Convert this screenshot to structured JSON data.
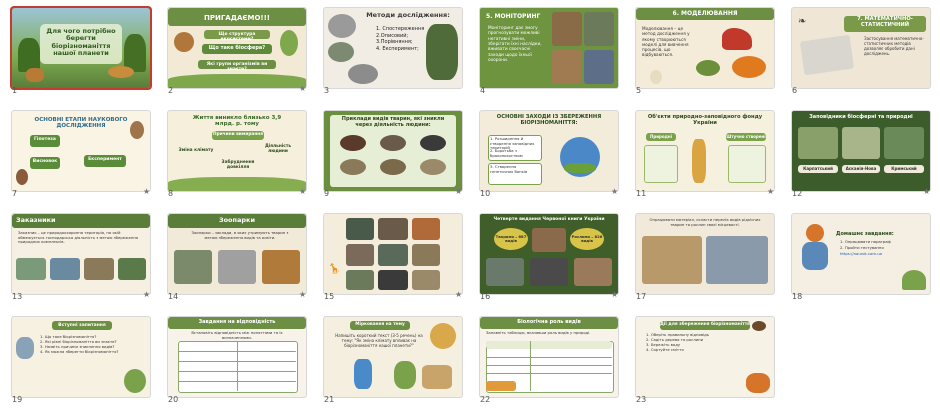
{
  "slides": [
    {
      "num": "1",
      "title": "Для чого потрібно берегти біорізноманіття нашої планети",
      "selected": true
    },
    {
      "num": "2",
      "title": "ПРИГАДАЄМО!!!",
      "q1": "Що структура екосистеми?",
      "q2": "Що таке біосфера?",
      "q3": "Які групи організмів ви знаєте?"
    },
    {
      "num": "3",
      "title": "Методи дослідження:",
      "items": [
        "1. Спостереження",
        "2.Описовий;",
        "3.Порівняння;",
        "4. Експеримент;"
      ]
    },
    {
      "num": "4",
      "title": "5. МОНІТОРИНГ",
      "text": "Моніторинг дає змогу прогнозувати можливі негативні зміни, зберігати їхні наслідки, вживати своєчасні заходи щодо їхньої охорони."
    },
    {
      "num": "5",
      "title": "6. МОДЕЛЮВАННЯ",
      "text": "Моделювання – це метод дослідження у якому створюються моделі для вивчення процесів, що відбуваються."
    },
    {
      "num": "6",
      "title": "7. МАТЕМАТИЧНО-СТАТИСТИЧНИЙ",
      "text": "Застосування математично-статистичних методів дозволяє обробити дані досліджень."
    },
    {
      "num": "7",
      "title": "ОСНОВНІ ЕТАПИ НАУКОВОГО ДОСЛІДЖЕННЯ",
      "labels": [
        "Гіпотеза",
        "Висновок",
        "Експеримент"
      ]
    },
    {
      "num": "8",
      "title": "Життя виникло близько 3,9 млрд. р. тому",
      "labels": [
        "Причини вимирання",
        "Зміна клімату",
        "Діяльність людини",
        "Забруднення довкілля"
      ]
    },
    {
      "num": "9",
      "title": "Приклади видів тварин, які зникли через діяльність людини:"
    },
    {
      "num": "10",
      "title": "ОСНОВНІ ЗАХОДИ ІЗ ЗБЕРЕЖЕННЯ БІОРІЗНОМАНІТТЯ:",
      "items": [
        "1. Розширення й створення заповідних територій",
        "2. Боротьба з браконьєрством",
        "3. Створення генетичних банків"
      ]
    },
    {
      "num": "11",
      "title": "Об'єкти природно-заповідного фонду України",
      "labels": [
        "Природні",
        "Штучно створені"
      ]
    },
    {
      "num": "12",
      "title": "Заповідники біосферні та природні",
      "labels": [
        "Карпатський",
        "Асканія-Нова",
        "Кримський"
      ]
    },
    {
      "num": "13",
      "title": "Заказники",
      "text": "Заказник – це природоохоронна територія, на якій обмежується господарська діяльність з метою збереження природних комплексів."
    },
    {
      "num": "14",
      "title": "Зоопарки",
      "text": "Зоопарки – заклади, в яких утримують тварин з метою збереження видів та освіти."
    },
    {
      "num": "15",
      "title": ""
    },
    {
      "num": "16",
      "title": "Четверте видання Червоної книги України",
      "labels": [
        "Тварини – 687 видів",
        "Рослини – 826 видів"
      ]
    },
    {
      "num": "17",
      "title": "",
      "text": "Опрацювати матеріал, скласти перелік видів рідкісних тварин та рослин своєї місцевості."
    },
    {
      "num": "18",
      "title": "Домашнє завдання:",
      "items": [
        "1. Опрацювати параграф",
        "2. Пройти тестування"
      ],
      "link": "https://naurok.com.ua"
    },
    {
      "num": "19",
      "title": "Вступні запитання",
      "items": [
        "1. Що таке біорізноманіття?",
        "2. Які рівні біорізноманіття ви знаєте?",
        "3. Назвіть причини зникнення видів?",
        "4. Як можна зберегти біорізноманіття?"
      ]
    },
    {
      "num": "20",
      "title": "Завдання на відповідність",
      "text": "Встановіть відповідність між поняттями та їх визначеннями."
    },
    {
      "num": "21",
      "title": "Мірковання на тему",
      "text": "Напишіть короткий текст (3-5 речень) на тему: \"Як зміна клімату впливає на біорізноманіття нашої планети?\""
    },
    {
      "num": "22",
      "title": "Біологічна роль видів",
      "text": "Заповніть таблицю, вказавши роль видів у природі."
    },
    {
      "num": "23",
      "title": "Дії для збереження біорізноманіття",
      "items": [
        "1. Оберіть правильну відповідь",
        "2. Садіть дерева та рослини",
        "3. Бережіть воду",
        "4. Сортуйте сміття"
      ]
    }
  ],
  "colors": {
    "green": "#5a7d3a",
    "dark_green": "#3f5e2a",
    "cream": "#f6eddc",
    "beige": "#efe4cf",
    "accent": "#c43b2f"
  }
}
